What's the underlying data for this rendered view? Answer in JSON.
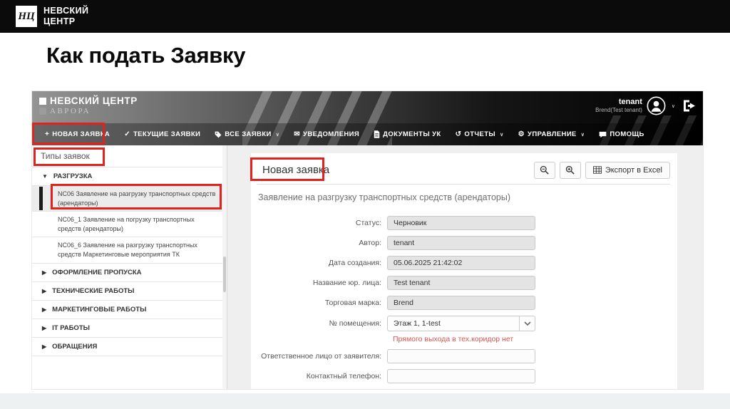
{
  "slide": {
    "title": "Как подать Заявку",
    "brand": {
      "monogram": "НЦ",
      "line1": "НЕВСКИЙ",
      "line2": "ЦЕНТР"
    }
  },
  "app": {
    "header": {
      "brand_line1": "НЕВСКИЙ ЦЕНТР",
      "brand_line2": "АВРОРА",
      "nav": [
        {
          "label": "НОВАЯ ЗАЯВКА",
          "icon": "plus-icon",
          "has_dropdown": false
        },
        {
          "label": "ТЕКУЩИЕ ЗАЯВКИ",
          "icon": "check-icon",
          "has_dropdown": false
        },
        {
          "label": "ВСЕ ЗАЯВКИ",
          "icon": "tag-icon",
          "has_dropdown": true
        },
        {
          "label": "УВЕДОМЛЕНИЯ",
          "icon": "envelope-icon",
          "has_dropdown": false
        },
        {
          "label": "ДОКУМЕНТЫ УК",
          "icon": "document-icon",
          "has_dropdown": false
        },
        {
          "label": "ОТЧЕТЫ",
          "icon": "history-icon",
          "has_dropdown": true
        },
        {
          "label": "УПРАВЛЕНИЕ",
          "icon": "gears-icon",
          "has_dropdown": true
        },
        {
          "label": "ПОМОЩЬ",
          "icon": "chat-icon",
          "has_dropdown": false
        }
      ],
      "nav_glyphs": {
        "plus": "+",
        "check": "✓",
        "envelope": "✉",
        "history": "↺",
        "gears": "⚙",
        "caret": "∨"
      },
      "user": {
        "name": "tenant",
        "org": "Brend(Test tenant)"
      }
    },
    "sidebar": {
      "title": "Типы заявок",
      "groups": [
        {
          "label": "РАЗГРУЗКА",
          "expanded": true
        },
        {
          "label": "ОФОРМЛЕНИЕ ПРОПУСКА",
          "expanded": false
        },
        {
          "label": "ТЕХНИЧЕСКИЕ РАБОТЫ",
          "expanded": false
        },
        {
          "label": "МАРКЕТИНГОВЫЕ РАБОТЫ",
          "expanded": false
        },
        {
          "label": "IT РАБОТЫ",
          "expanded": false
        },
        {
          "label": "ОБРАЩЕНИЯ",
          "expanded": false
        }
      ],
      "tree_glyphs": {
        "expanded": "▼",
        "collapsed": "▶"
      },
      "razgruzka_items": [
        {
          "label": "NC06 Заявление на разгрузку транспортных средств (арендаторы)",
          "selected": true
        },
        {
          "label": "NC06_1 Заявление на погрузку транспортных средств (арендаторы)",
          "selected": false
        },
        {
          "label": "NC06_6 Заявление на разгрузку транспортных средств Маркетинговые мероприятия ТК",
          "selected": false
        }
      ]
    },
    "main": {
      "title": "Новая заявка",
      "toolbar": {
        "export_label": "Экспорт в Excel"
      },
      "form_title": "Заявление на разгрузку транспортных средств (арендаторы)",
      "fields": [
        {
          "label": "Статус:",
          "value": "Черновик"
        },
        {
          "label": "Автор:",
          "value": "tenant"
        },
        {
          "label": "Дата создания:",
          "value": "05.06.2025 21:42:02"
        },
        {
          "label": "Название юр. лица:",
          "value": "Test tenant"
        },
        {
          "label": "Торговая марка:",
          "value": "Brend"
        },
        {
          "label": "№ помещения:",
          "value": "Этаж 1, 1-test",
          "note": "Прямого выхода в тех.коридор нет"
        },
        {
          "label": "Ответственное лицо от заявителя:",
          "value": ""
        },
        {
          "label": "Контактный телефон:",
          "value": ""
        }
      ]
    }
  },
  "colors": {
    "annotation_red": "#e2231d",
    "warning_red": "#d9534f",
    "header_black": "#0b0b0b"
  }
}
